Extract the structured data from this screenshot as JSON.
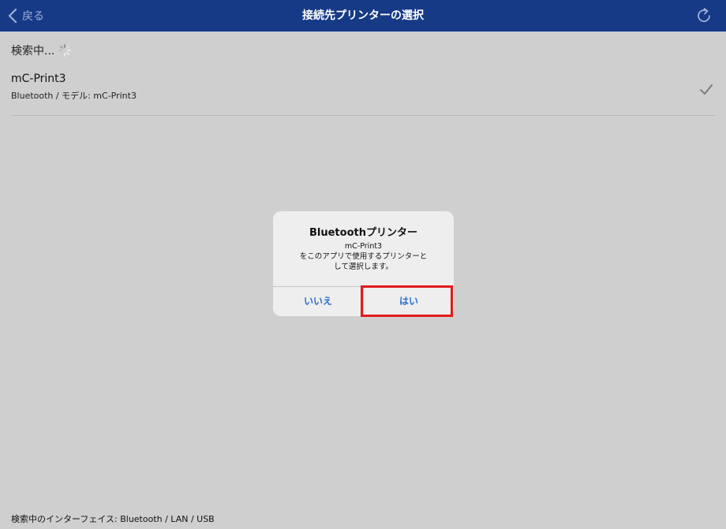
{
  "navbar": {
    "back_label": "戻る",
    "title": "接続先プリンターの選択"
  },
  "status": {
    "searching_label": "検索中..."
  },
  "printers": [
    {
      "name": "mC-Print3",
      "detail": "Bluetooth / モデル: mC-Print3",
      "selected": true
    }
  ],
  "footer": {
    "interfaces_label": "検索中のインターフェイス: Bluetooth / LAN / USB"
  },
  "dialog": {
    "title": "Bluetoothプリンター",
    "message_lines": [
      "mC-Print3",
      "をこのアプリで使用するプリンターと",
      "して選択します。"
    ],
    "no_label": "いいえ",
    "yes_label": "はい"
  },
  "colors": {
    "navbar": "#173a87",
    "background": "#cfcfcf",
    "button_text": "#2a6fd1",
    "highlight": "#e21b1b"
  }
}
